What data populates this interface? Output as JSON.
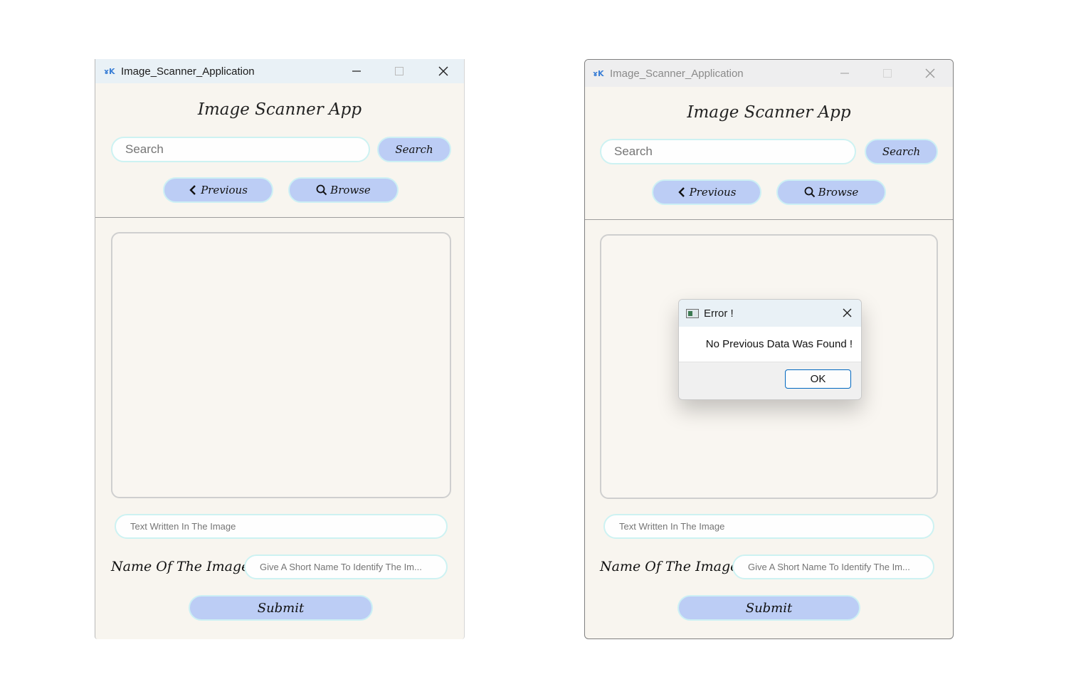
{
  "left_window": {
    "title": "Image_Scanner_Application",
    "heading": "Image Scanner App",
    "search_placeholder": "Search",
    "search_button": "Search",
    "previous_button": "Previous",
    "browse_button": "Browse",
    "text_field_placeholder": "Text Written In The Image",
    "name_label": "Name Of The Image",
    "name_placeholder": "Give A Short Name To Identify The Im...",
    "submit_button": "Submit"
  },
  "right_window": {
    "title": "Image_Scanner_Application",
    "heading": "Image Scanner App",
    "search_placeholder": "Search",
    "search_button": "Search",
    "previous_button": "Previous",
    "browse_button": "Browse",
    "text_field_placeholder": "Text Written In The Image",
    "name_label": "Name Of The Image",
    "name_placeholder": "Give A Short Name To Identify The Im...",
    "submit_button": "Submit",
    "dialog": {
      "title": "Error !",
      "message": "No Previous Data Was Found !",
      "ok_button": "OK"
    }
  },
  "colors": {
    "window_bg": "#f8f5ef",
    "button_bg": "#bccdf5",
    "input_border": "#cdf2f2"
  },
  "icons": [
    "app-icon",
    "minimize-icon",
    "maximize-icon",
    "close-icon",
    "chevron-left-icon",
    "search-icon",
    "dialog-app-icon"
  ]
}
